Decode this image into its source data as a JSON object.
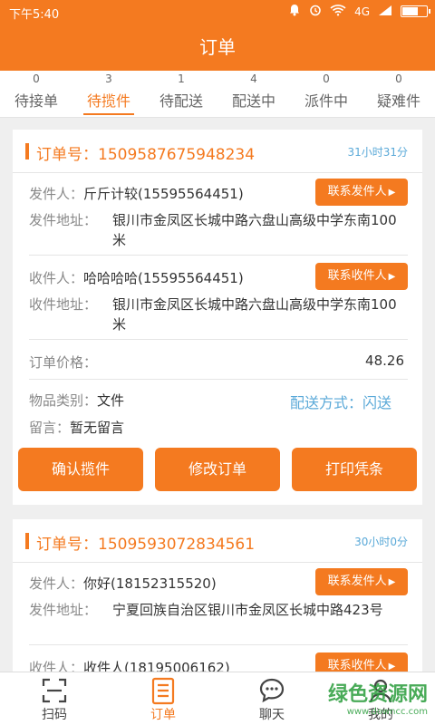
{
  "status": {
    "time": "下午5:40",
    "signal": "4G"
  },
  "title": "订单",
  "tabs": [
    {
      "count": "0",
      "label": "待接单"
    },
    {
      "count": "3",
      "label": "待揽件"
    },
    {
      "count": "1",
      "label": "待配送"
    },
    {
      "count": "4",
      "label": "配送中"
    },
    {
      "count": "0",
      "label": "派件中"
    },
    {
      "count": "0",
      "label": "疑难件"
    }
  ],
  "orders": [
    {
      "order_no": "订单号：1509587675948234",
      "elapsed": "31小时31分",
      "sender_label": "发件人：",
      "sender": "斤斤计较(15595564451)",
      "contact_sender": "联系发件人",
      "sender_addr_label": "发件地址：",
      "sender_addr": "银川市金凤区长城中路六盘山高级中学东南100米",
      "receiver_label": "收件人：",
      "receiver": "哈哈哈哈(15595564451)",
      "contact_receiver": "联系收件人",
      "receiver_addr_label": "收件地址：",
      "receiver_addr": "银川市金凤区长城中路六盘山高级中学东南100米",
      "price_label": "订单价格：",
      "price": "48.26",
      "category_label": "物品类别：",
      "category": "文件",
      "delivery": "配送方式：闪送",
      "message_label": "留言：",
      "message": "暂无留言",
      "actions": [
        "确认揽件",
        "修改订单",
        "打印凭条"
      ]
    },
    {
      "order_no": "订单号：1509593072834561",
      "elapsed": "30小时0分",
      "sender_label": "发件人：",
      "sender": "你好(18152315520)",
      "contact_sender": "联系发件人",
      "sender_addr_label": "发件地址：",
      "sender_addr": "宁夏回族自治区银川市金凤区长城中路423号",
      "receiver_label": "收件人：",
      "receiver": "收件人(18195006162)",
      "contact_receiver": "联系收件人"
    }
  ],
  "nav": [
    {
      "label": "扫码",
      "icon": "scan-icon"
    },
    {
      "label": "订单",
      "icon": "order-list-icon"
    },
    {
      "label": "聊天",
      "icon": "chat-icon"
    },
    {
      "label": "我的",
      "icon": "user-icon"
    }
  ],
  "watermark": {
    "title": "绿色资源网",
    "url": "www.downcc.com"
  },
  "colors": {
    "accent": "#f47a20",
    "link": "#5aa9d8"
  }
}
